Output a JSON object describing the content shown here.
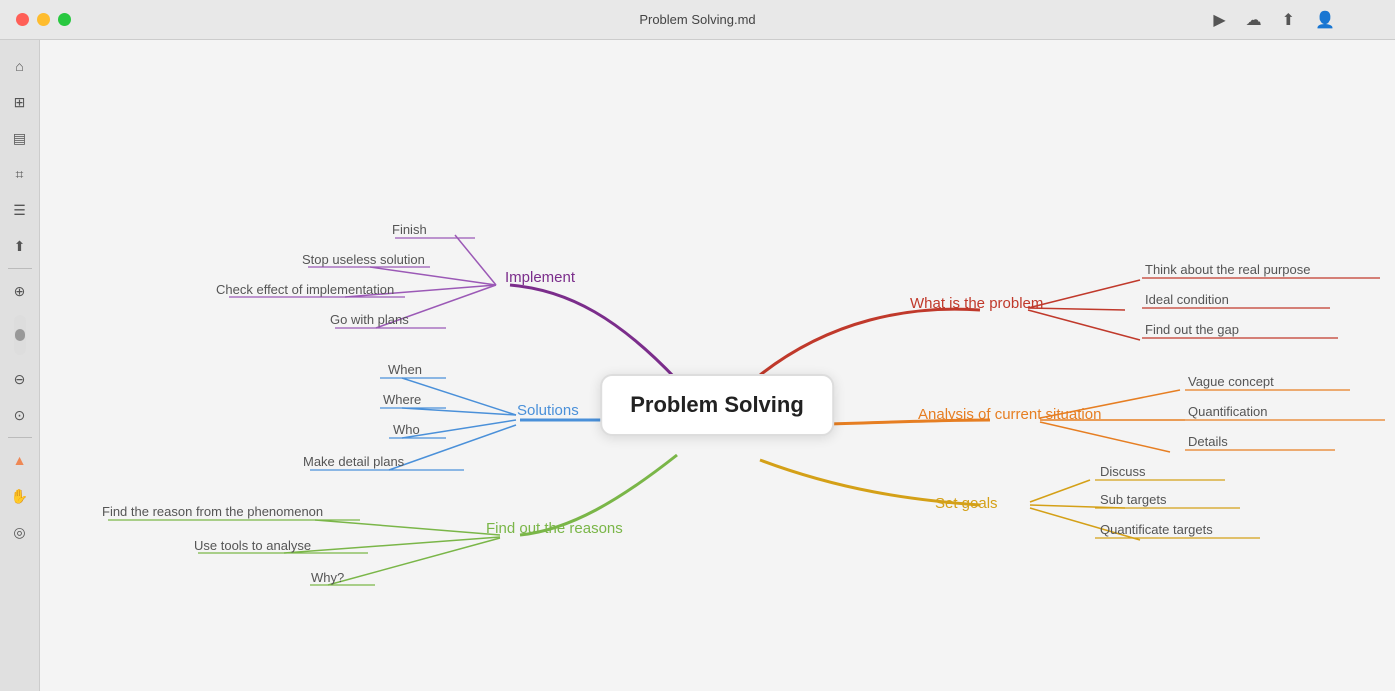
{
  "window": {
    "title": "Problem Solving.md"
  },
  "titlebar": {
    "buttons": [
      "close",
      "minimize",
      "maximize"
    ],
    "right_icons": [
      "play",
      "upload",
      "share",
      "profile"
    ]
  },
  "sidebar": {
    "icons": [
      "home",
      "network",
      "layers",
      "tag",
      "list",
      "export",
      "divider",
      "zoom-in",
      "scroll",
      "zoom-out",
      "globe",
      "divider2",
      "cursor",
      "hand",
      "eye"
    ]
  },
  "center_node": {
    "label": "Problem Solving"
  },
  "branches": {
    "implement": {
      "label": "Implement",
      "color": "#7B2D8B",
      "children": [
        "Finish",
        "Stop useless solution",
        "Check effect of implementation",
        "Go with plans"
      ]
    },
    "solutions": {
      "label": "Solutions",
      "color": "#4A90D9",
      "children": [
        "When",
        "Where",
        "Who",
        "Make detail plans"
      ]
    },
    "find_out_reasons": {
      "label": "Find out the reasons",
      "color": "#7AB648",
      "children": [
        "Find the reason from the phenomenon",
        "Use tools to analyse",
        "Why?"
      ]
    },
    "what_is_problem": {
      "label": "What is the problem",
      "color": "#C0392B",
      "children": [
        "Think about the real purpose",
        "Ideal condition",
        "Find out the gap"
      ]
    },
    "analysis": {
      "label": "Analysis of current situation",
      "color": "#E67E22",
      "children": [
        "Vague concept",
        "Quantification",
        "Details"
      ]
    },
    "set_goals": {
      "label": "Set goals",
      "color": "#F0C040",
      "children": [
        "Discuss",
        "Sub targets",
        "Quantificate targets"
      ]
    }
  }
}
